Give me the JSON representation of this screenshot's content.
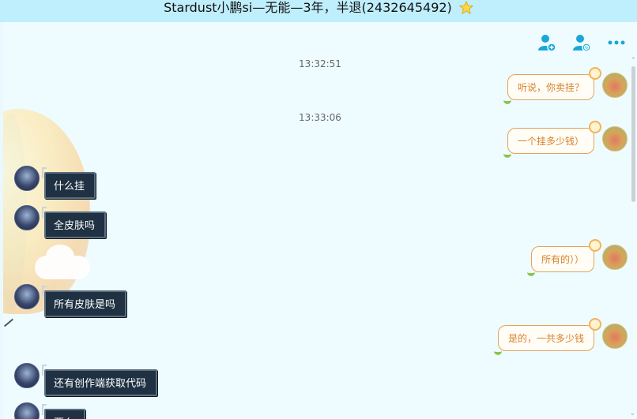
{
  "window": {
    "title": "Stardust小鹏si—无能—3年，半退(2432645492)",
    "title_icon": "star-icon"
  },
  "header": {
    "icons": [
      "add-contact-icon",
      "block-contact-icon",
      "more-icon"
    ],
    "accent_color": "#1aa7d8"
  },
  "timestamps": [
    "13:32:51",
    "13:33:06"
  ],
  "messages": [
    {
      "side": "right",
      "text": "听说，你卖挂？"
    },
    {
      "side": "right",
      "text": "一个挂多少钱）"
    },
    {
      "side": "left",
      "text": "什么挂"
    },
    {
      "side": "left",
      "text": "全皮肤吗"
    },
    {
      "side": "right",
      "text": "所有的））"
    },
    {
      "side": "left",
      "text": "所有皮肤是吗"
    },
    {
      "side": "right",
      "text": "是的，一共多少钱"
    },
    {
      "side": "left",
      "text": "还有创作端获取代码"
    },
    {
      "side": "left",
      "text": "要么"
    }
  ]
}
